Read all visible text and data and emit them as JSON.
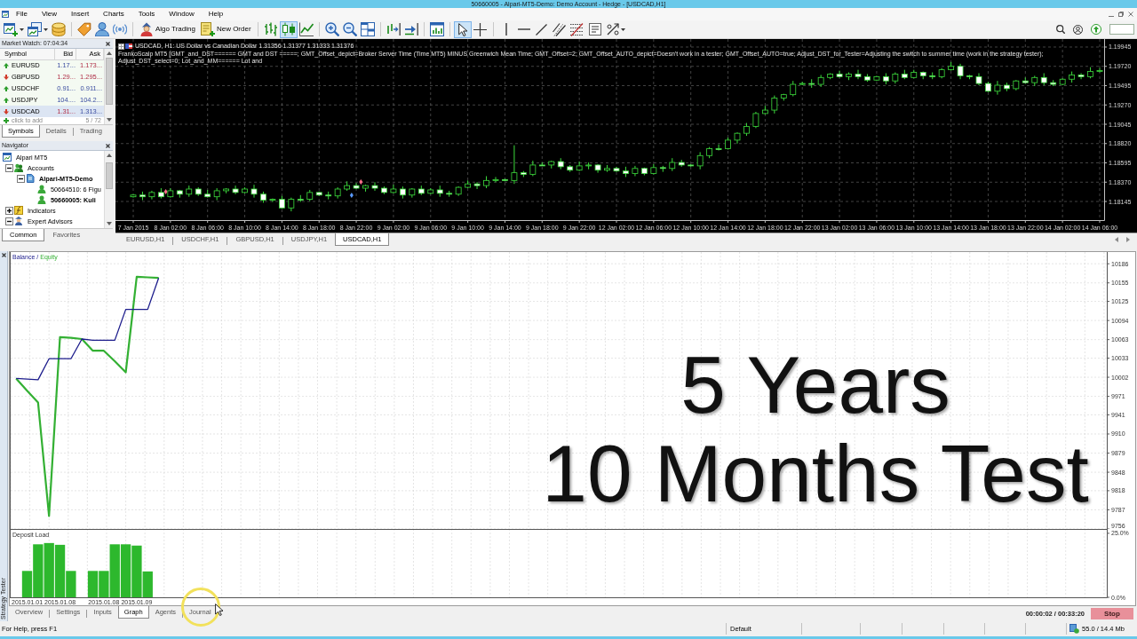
{
  "window": {
    "title": "50660005 - Alpari-MT5-Demo: Demo Account - Hedge - [USDCAD,H1]"
  },
  "menu": [
    "File",
    "View",
    "Insert",
    "Charts",
    "Tools",
    "Window",
    "Help"
  ],
  "toolbar": [
    [
      {
        "kind": "new-chart",
        "dropdown": true,
        "selected": false
      },
      {
        "kind": "profiles",
        "dropdown": true,
        "selected": false
      },
      {
        "kind": "market-watch",
        "dropdown": false,
        "selected": false
      }
    ],
    [
      {
        "kind": "data-window",
        "dropdown": false,
        "selected": false
      },
      {
        "kind": "navigator",
        "dropdown": false,
        "selected": false
      },
      {
        "kind": "signals",
        "dropdown": false,
        "selected": false
      }
    ],
    [
      {
        "kind": "algo-trading",
        "label": "Algo Trading",
        "dropdown": false,
        "selected": false
      },
      {
        "kind": "new-order",
        "label": "New Order",
        "dropdown": false,
        "selected": false
      }
    ],
    [
      {
        "kind": "bar-chart",
        "dropdown": false,
        "selected": false
      },
      {
        "kind": "candlestick-chart",
        "dropdown": false,
        "selected": true
      },
      {
        "kind": "line-chart",
        "dropdown": false,
        "selected": false
      }
    ],
    [
      {
        "kind": "zoom-in",
        "dropdown": false,
        "selected": false
      },
      {
        "kind": "zoom-out",
        "dropdown": false,
        "selected": false
      },
      {
        "kind": "tile-windows",
        "dropdown": false,
        "selected": false
      }
    ],
    [
      {
        "kind": "chart-shift",
        "dropdown": false,
        "selected": false
      },
      {
        "kind": "autoscroll",
        "dropdown": false,
        "selected": false
      }
    ],
    [
      {
        "kind": "templates",
        "dropdown": false,
        "selected": false
      }
    ],
    [
      {
        "kind": "cursor",
        "dropdown": false,
        "selected": true
      },
      {
        "kind": "crosshair",
        "dropdown": false,
        "selected": false
      }
    ],
    [
      {
        "kind": "vertical-line",
        "dropdown": false,
        "selected": false
      },
      {
        "kind": "horizontal-line",
        "dropdown": false,
        "selected": false
      },
      {
        "kind": "trend-line",
        "dropdown": false,
        "selected": false
      },
      {
        "kind": "channel",
        "dropdown": false,
        "selected": false
      },
      {
        "kind": "fibonacci",
        "dropdown": false,
        "selected": false
      },
      {
        "kind": "text-label",
        "dropdown": false,
        "selected": false
      },
      {
        "kind": "arrows",
        "dropdown": true,
        "selected": false
      }
    ]
  ],
  "market_watch": {
    "title": "Market Watch: 07:04:34",
    "columns": [
      "Symbol",
      "Bid",
      "Ask"
    ],
    "rows": [
      {
        "symbol": "EURUSD",
        "rising": true,
        "bid": "1.17...",
        "bid_down": false,
        "ask": "1.173...",
        "ask_down": true,
        "selected": false
      },
      {
        "symbol": "GBPUSD",
        "rising": false,
        "bid": "1.29...",
        "bid_down": true,
        "ask": "1.295...",
        "ask_down": true,
        "selected": false
      },
      {
        "symbol": "USDCHF",
        "rising": true,
        "bid": "0.91...",
        "bid_down": false,
        "ask": "0.911...",
        "ask_down": false,
        "selected": false
      },
      {
        "symbol": "USDJPY",
        "rising": true,
        "bid": "104....",
        "bid_down": false,
        "ask": "104.2...",
        "ask_down": false,
        "selected": false
      },
      {
        "symbol": "USDCAD",
        "rising": false,
        "bid": "1.31...",
        "bid_down": true,
        "ask": "1.313...",
        "ask_down": false,
        "selected": true
      }
    ],
    "add_row": {
      "label": "click to add",
      "count": "5 / 72"
    },
    "tabs": [
      {
        "label": "Symbols",
        "selected": true
      },
      {
        "label": "Details",
        "selected": false
      },
      {
        "label": "Trading",
        "selected": false
      }
    ]
  },
  "navigator": {
    "title": "Navigator",
    "tree": [
      {
        "label": "Alpari MT5",
        "kind": "terminal",
        "active": false,
        "children": [
          {
            "label": "Accounts",
            "kind": "accounts",
            "expanded": true,
            "active": false,
            "children": [
              {
                "label": "Alpari-MT5-Demo",
                "kind": "server",
                "expanded": true,
                "active": true,
                "children": [
                  {
                    "label": "50664510: 6 Figu",
                    "kind": "account",
                    "active": false
                  },
                  {
                    "label": "50660005: Kuli",
                    "kind": "account",
                    "active": true
                  }
                ]
              }
            ]
          },
          {
            "label": "Indicators",
            "kind": "indicators",
            "expanded": false,
            "active": false
          },
          {
            "label": "Expert Advisors",
            "kind": "experts",
            "expanded": true,
            "active": false
          }
        ]
      }
    ],
    "tabs": [
      {
        "label": "Common",
        "selected": true
      },
      {
        "label": "Favorites",
        "selected": false
      }
    ]
  },
  "chart": {
    "header": "USDCAD, H1: US Dollar vs Canadian Dollar 1.31356 1.31377 1.31333 1.31376",
    "indicator": "FrankoScalp MT5 [GMT_and_DST====== GMT and DST =====; GMT_Offset_depict=Broker Server Time (Time MT5) MINUS Greenwich Mean Time; GMT_Offset=2; GMT_Offset_AUTO_depict=Doesn't work in a tester; GMT_Offset_AUTO=true; Adjust_DST_for_Tester=Adjusting the switch to summer time (work in the strategy tester); Adjust_DST_select=0; Lot_and_MM====== Lot and",
    "chart_data": {
      "type": "candlestick",
      "grid": true,
      "categories": [
        "7 Jan 2015",
        null,
        null,
        null,
        "8 Jan 02:00",
        null,
        null,
        null,
        "8 Jan 06:00",
        null,
        null,
        null,
        "8 Jan 10:00",
        null,
        null,
        null,
        "8 Jan 14:00",
        null,
        null,
        null,
        "8 Jan 18:00",
        null,
        null,
        null,
        "8 Jan 22:00",
        null,
        null,
        null,
        "9 Jan 02:00",
        null,
        null,
        null,
        "9 Jan 06:00",
        null,
        null,
        null,
        "9 Jan 10:00",
        null,
        null,
        null,
        "9 Jan 14:00",
        null,
        null,
        null,
        "9 Jan 18:00",
        null,
        null,
        null,
        "9 Jan 22:00",
        null,
        null,
        null,
        "12 Jan 02:00",
        null,
        null,
        null,
        "12 Jan 06:00",
        null,
        null,
        null,
        "12 Jan 10:00",
        null,
        null,
        null,
        "12 Jan 14:00",
        null,
        null,
        null,
        "12 Jan 18:00",
        null,
        null,
        null,
        "12 Jan 22:00",
        null,
        null,
        null,
        "13 Jan 02:00",
        null,
        null,
        null,
        "13 Jan 06:00",
        null,
        null,
        null,
        "13 Jan 10:00",
        null,
        null,
        null,
        "13 Jan 14:00",
        null,
        null,
        null,
        "13 Jan 18:00",
        null,
        null,
        null,
        "13 Jan 22:00",
        null,
        null,
        null,
        "14 Jan 02:00",
        null,
        null,
        null,
        "14 Jan 06:00"
      ],
      "ohlc": [
        [
          1.182,
          1.1823,
          1.1819,
          1.1822
        ],
        [
          1.1822,
          1.1826,
          1.1816,
          1.182
        ],
        [
          1.182,
          1.1827,
          1.1817,
          1.1825
        ],
        [
          1.1825,
          1.183,
          1.1818,
          1.182
        ],
        [
          1.182,
          1.183,
          1.1819,
          1.1827
        ],
        [
          1.1827,
          1.1828,
          1.1819,
          1.1823
        ],
        [
          1.1823,
          1.1833,
          1.182,
          1.1829
        ],
        [
          1.1829,
          1.1831,
          1.1821,
          1.1823
        ],
        [
          1.1823,
          1.1828,
          1.1819,
          1.182
        ],
        [
          1.182,
          1.183,
          1.1816,
          1.1827
        ],
        [
          1.1827,
          1.183,
          1.1824,
          1.1829
        ],
        [
          1.1829,
          1.1833,
          1.1823,
          1.1825
        ],
        [
          1.1825,
          1.1831,
          1.1824,
          1.1829
        ],
        [
          1.1829,
          1.1834,
          1.1819,
          1.1823
        ],
        [
          1.1823,
          1.1826,
          1.1813,
          1.1816
        ],
        [
          1.1816,
          1.1818,
          1.1814,
          1.1817
        ],
        [
          1.1817,
          1.1821,
          1.1806,
          1.1807
        ],
        [
          1.1807,
          1.1819,
          1.1803,
          1.1817
        ],
        [
          1.1817,
          1.1822,
          1.1814,
          1.1817
        ],
        [
          1.1817,
          1.1828,
          1.1815,
          1.1825
        ],
        [
          1.1825,
          1.1826,
          1.1821,
          1.1822
        ],
        [
          1.1822,
          1.1826,
          1.1817,
          1.1821
        ],
        [
          1.1821,
          1.1831,
          1.1818,
          1.1829
        ],
        [
          1.1829,
          1.1838,
          1.1827,
          1.1833
        ],
        [
          1.1833,
          1.1836,
          1.1829,
          1.183
        ],
        [
          1.183,
          1.1834,
          1.1826,
          1.1833
        ],
        [
          1.1833,
          1.1837,
          1.1827,
          1.183
        ],
        [
          1.183,
          1.1832,
          1.1823,
          1.1825
        ],
        [
          1.1825,
          1.1834,
          1.1824,
          1.1829
        ],
        [
          1.1829,
          1.1832,
          1.1818,
          1.1822
        ],
        [
          1.1822,
          1.183,
          1.1819,
          1.1829
        ],
        [
          1.1829,
          1.1833,
          1.1822,
          1.1824
        ],
        [
          1.1824,
          1.183,
          1.1823,
          1.1828
        ],
        [
          1.1828,
          1.1833,
          1.182,
          1.1824
        ],
        [
          1.1824,
          1.1827,
          1.182,
          1.1823
        ],
        [
          1.1823,
          1.1832,
          1.1821,
          1.1831
        ],
        [
          1.1831,
          1.1839,
          1.183,
          1.1835
        ],
        [
          1.1835,
          1.1837,
          1.1829,
          1.1833
        ],
        [
          1.1833,
          1.1844,
          1.183,
          1.1839
        ],
        [
          1.1839,
          1.1843,
          1.1837,
          1.184
        ],
        [
          1.184,
          1.1841,
          1.1838,
          1.1839
        ],
        [
          1.1839,
          1.188,
          1.1835,
          1.1848
        ],
        [
          1.1848,
          1.185,
          1.1843,
          1.1846
        ],
        [
          1.1846,
          1.1862,
          1.1844,
          1.1857
        ],
        [
          1.1857,
          1.186,
          1.1856,
          1.1857
        ],
        [
          1.1857,
          1.1862,
          1.1853,
          1.1861
        ],
        [
          1.1861,
          1.1865,
          1.1852,
          1.1855
        ],
        [
          1.1855,
          1.1857,
          1.1849,
          1.1851
        ],
        [
          1.1851,
          1.1861,
          1.185,
          1.1856
        ],
        [
          1.1856,
          1.186,
          1.1852,
          1.1857
        ],
        [
          1.1857,
          1.1858,
          1.1848,
          1.1851
        ],
        [
          1.1851,
          1.1857,
          1.1849,
          1.1853
        ],
        [
          1.1853,
          1.1855,
          1.1849,
          1.185
        ],
        [
          1.185,
          1.1855,
          1.1843,
          1.1847
        ],
        [
          1.1847,
          1.1856,
          1.1844,
          1.1853
        ],
        [
          1.1853,
          1.1854,
          1.1845,
          1.1847
        ],
        [
          1.1847,
          1.1858,
          1.1846,
          1.1854
        ],
        [
          1.1854,
          1.1856,
          1.1849,
          1.1853
        ],
        [
          1.1853,
          1.1865,
          1.185,
          1.186
        ],
        [
          1.186,
          1.1863,
          1.1855,
          1.1857
        ],
        [
          1.1857,
          1.1858,
          1.1855,
          1.1856
        ],
        [
          1.1856,
          1.1872,
          1.1852,
          1.1868
        ],
        [
          1.1868,
          1.1878,
          1.1865,
          1.1876
        ],
        [
          1.1876,
          1.1881,
          1.1874,
          1.1876
        ],
        [
          1.1876,
          1.1889,
          1.1875,
          1.1886
        ],
        [
          1.1886,
          1.1895,
          1.1882,
          1.1894
        ],
        [
          1.1894,
          1.1906,
          1.1891,
          1.1902
        ],
        [
          1.1902,
          1.1919,
          1.19,
          1.1917
        ],
        [
          1.1917,
          1.1926,
          1.1916,
          1.1921
        ],
        [
          1.1921,
          1.1938,
          1.1917,
          1.1935
        ],
        [
          1.1935,
          1.194,
          1.1932,
          1.1939
        ],
        [
          1.1939,
          1.1955,
          1.1937,
          1.1951
        ],
        [
          1.1951,
          1.1954,
          1.195,
          1.1952
        ],
        [
          1.1952,
          1.1957,
          1.1947,
          1.1951
        ],
        [
          1.1951,
          1.1962,
          1.1948,
          1.1959
        ],
        [
          1.1959,
          1.1964,
          1.1957,
          1.1963
        ],
        [
          1.1963,
          1.1967,
          1.1959,
          1.196
        ],
        [
          1.196,
          1.1965,
          1.1956,
          1.1963
        ],
        [
          1.1963,
          1.1968,
          1.1957,
          1.196
        ],
        [
          1.196,
          1.1963,
          1.1954,
          1.1956
        ],
        [
          1.1956,
          1.1961,
          1.1955,
          1.196
        ],
        [
          1.196,
          1.1964,
          1.1951,
          1.1955
        ],
        [
          1.1955,
          1.1965,
          1.1952,
          1.1963
        ],
        [
          1.1963,
          1.1968,
          1.1957,
          1.1959
        ],
        [
          1.1959,
          1.1968,
          1.1958,
          1.1965
        ],
        [
          1.1965,
          1.1966,
          1.1957,
          1.1961
        ],
        [
          1.1961,
          1.1965,
          1.1957,
          1.196
        ],
        [
          1.196,
          1.197,
          1.1958,
          1.1968
        ],
        [
          1.1968,
          1.1977,
          1.1967,
          1.1972
        ],
        [
          1.1972,
          1.1975,
          1.1957,
          1.1961
        ],
        [
          1.1961,
          1.1962,
          1.1957,
          1.196
        ],
        [
          1.196,
          1.1964,
          1.195,
          1.1952
        ],
        [
          1.1952,
          1.1954,
          1.1942,
          1.1943
        ],
        [
          1.1943,
          1.1955,
          1.1939,
          1.195
        ],
        [
          1.195,
          1.1953,
          1.1943,
          1.1946
        ],
        [
          1.1946,
          1.1956,
          1.1944,
          1.1955
        ],
        [
          1.1955,
          1.1959,
          1.1952,
          1.1953
        ],
        [
          1.1953,
          1.1961,
          1.1949,
          1.1959
        ],
        [
          1.1959,
          1.1964,
          1.195,
          1.1953
        ],
        [
          1.1953,
          1.1956,
          1.1949,
          1.1951
        ],
        [
          1.1951,
          1.1958,
          1.195,
          1.1957
        ],
        [
          1.1957,
          1.1966,
          1.1953,
          1.1962
        ],
        [
          1.1962,
          1.1964,
          1.1957,
          1.196
        ],
        [
          1.196,
          1.1971,
          1.1958,
          1.1966
        ],
        [
          1.1966,
          1.197,
          1.1965,
          1.1967
        ]
      ],
      "ylim": [
        1.17928,
        1.20038
      ],
      "yticks": [
        {
          "value": 1.19945,
          "label": "1.19945"
        },
        {
          "value": 1.1972,
          "label": "1.19720"
        },
        {
          "value": 1.19495,
          "label": "1.19495"
        },
        {
          "value": 1.1927,
          "label": "1.19270"
        },
        {
          "value": 1.19045,
          "label": "1.19045"
        },
        {
          "value": 1.1882,
          "label": "1.18820"
        },
        {
          "value": 1.18595,
          "label": "1.18595"
        },
        {
          "value": 1.1837,
          "label": "1.18370"
        },
        {
          "value": 1.18145,
          "label": "1.18145"
        }
      ]
    },
    "tabs": [
      {
        "label": "EURUSD,H1",
        "selected": false
      },
      {
        "label": "USDCHF,H1",
        "selected": false
      },
      {
        "label": "GBPUSD,H1",
        "selected": false
      },
      {
        "label": "USDJPY,H1",
        "selected": false
      },
      {
        "label": "USDCAD,H1",
        "selected": true
      }
    ]
  },
  "tester": {
    "side_title": "Strategy Tester",
    "balance_chart": {
      "legend_separator": "/",
      "chart_data": {
        "type": "line",
        "grid": true,
        "categories": [
          null,
          null,
          null,
          null,
          null,
          null,
          null,
          null,
          null,
          null,
          null,
          null,
          null,
          null,
          null,
          null,
          null,
          null,
          null,
          null,
          null,
          null,
          null,
          null,
          null,
          null,
          null,
          null,
          null,
          null,
          null,
          null,
          null,
          null,
          null,
          null,
          null,
          null,
          null,
          null,
          null,
          null,
          null,
          null,
          null,
          null,
          null,
          null,
          null,
          null,
          null,
          null,
          null,
          null,
          null,
          null,
          null,
          null,
          null,
          null,
          null,
          null,
          null,
          null,
          null,
          null,
          null,
          null,
          null,
          null,
          null,
          null,
          null,
          null,
          null,
          null,
          null,
          null,
          null,
          null,
          null,
          null,
          null,
          null,
          null,
          null,
          null,
          null,
          null,
          null,
          null,
          null,
          null,
          null,
          null,
          null,
          null,
          null,
          null,
          null
        ],
        "series": [
          {
            "name": "Balance",
            "color": "#1c1c8c",
            "values": [
              10000,
              9999,
              9998,
              10032,
              10032,
              10032,
              10064,
              10062,
              10062,
              10062,
              10112,
              10112,
              10112,
              10163,
              null,
              null,
              null,
              null,
              null,
              null,
              null,
              null,
              null,
              null,
              null,
              null,
              null,
              null,
              null,
              null,
              null,
              null,
              null,
              null,
              null,
              null,
              null,
              null,
              null,
              null,
              null,
              null,
              null,
              null,
              null,
              null,
              null,
              null,
              null,
              null,
              null,
              null,
              null,
              null,
              null,
              null,
              null,
              null,
              null,
              null,
              null,
              null,
              null,
              null,
              null,
              null,
              null,
              null,
              null,
              null,
              null,
              null,
              null,
              null,
              null,
              null,
              null,
              null,
              null,
              null,
              null,
              null,
              null,
              null,
              null,
              null,
              null,
              null,
              null,
              null,
              null,
              null,
              null,
              null,
              null,
              null,
              null,
              null,
              null,
              null
            ]
          },
          {
            "name": "Equity",
            "color": "#33b033",
            "values": [
              10000,
              9980,
              9961,
              9777,
              10067,
              10066,
              10064,
              10045,
              10045,
              10028,
              10010,
              10165,
              10164,
              10163,
              null,
              null,
              null,
              null,
              null,
              null,
              null,
              null,
              null,
              null,
              null,
              null,
              null,
              null,
              null,
              null,
              null,
              null,
              null,
              null,
              null,
              null,
              null,
              null,
              null,
              null,
              null,
              null,
              null,
              null,
              null,
              null,
              null,
              null,
              null,
              null,
              null,
              null,
              null,
              null,
              null,
              null,
              null,
              null,
              null,
              null,
              null,
              null,
              null,
              null,
              null,
              null,
              null,
              null,
              null,
              null,
              null,
              null,
              null,
              null,
              null,
              null,
              null,
              null,
              null,
              null,
              null,
              null,
              null,
              null,
              null,
              null,
              null,
              null,
              null,
              null,
              null,
              null,
              null,
              null,
              null,
              null,
              null,
              null,
              null,
              null
            ]
          }
        ],
        "ylim": [
          9756,
          10205
        ],
        "yticks": [
          10186,
          10155,
          10125,
          10094,
          10063,
          10033,
          10002,
          9971,
          9941,
          9910,
          9879,
          9848,
          9818,
          9787,
          9756
        ]
      }
    },
    "deposit_chart": {
      "chart_data": {
        "type": "bar",
        "grid": true,
        "title": "Deposit Load",
        "categories": [
          null,
          "2015.01.01",
          null,
          null,
          "2015.01.08",
          null,
          null,
          null,
          "2015.01.08",
          null,
          null,
          "2015.01.09",
          null,
          null,
          null,
          null,
          null,
          null,
          null,
          null,
          null,
          null,
          null,
          null,
          null,
          null,
          null,
          null,
          null,
          null,
          null,
          null,
          null,
          null,
          null,
          null,
          null,
          null,
          null,
          null,
          null,
          null,
          null,
          null,
          null,
          null,
          null,
          null,
          null,
          null,
          null,
          null,
          null,
          null,
          null,
          null,
          null,
          null,
          null,
          null,
          null,
          null,
          null,
          null,
          null,
          null,
          null,
          null,
          null,
          null,
          null,
          null,
          null,
          null,
          null,
          null,
          null,
          null,
          null,
          null,
          null,
          null,
          null,
          null,
          null,
          null,
          null,
          null,
          null,
          null,
          null,
          null,
          null,
          null,
          null,
          null,
          null,
          null,
          null,
          null
        ],
        "values": [
          null,
          10.3,
          20.7,
          21.2,
          20.5,
          10.3,
          null,
          10.3,
          10.3,
          20.7,
          20.7,
          20.2,
          10.1,
          null,
          null,
          null,
          null,
          null,
          null,
          null,
          null,
          null,
          null,
          null,
          null,
          null,
          null,
          null,
          null,
          null,
          null,
          null,
          null,
          null,
          null,
          null,
          null,
          null,
          null,
          null,
          null,
          null,
          null,
          null,
          null,
          null,
          null,
          null,
          null,
          null,
          null,
          null,
          null,
          null,
          null,
          null,
          null,
          null,
          null,
          null,
          null,
          null,
          null,
          null,
          null,
          null,
          null,
          null,
          null,
          null,
          null,
          null,
          null,
          null,
          null,
          null,
          null,
          null,
          null,
          null,
          null,
          null,
          null,
          null,
          null,
          null,
          null,
          null,
          null,
          null,
          null,
          null,
          null,
          null,
          null,
          null,
          null,
          null,
          null,
          null
        ],
        "ylim": [
          0,
          26.7
        ],
        "yticks": [
          {
            "value": 0,
            "label": "0.0%"
          },
          {
            "value": 25,
            "label": "25.0%"
          }
        ]
      }
    },
    "tabs": [
      {
        "label": "Overview",
        "selected": false
      },
      {
        "label": "Settings",
        "selected": false
      },
      {
        "label": "Inputs",
        "selected": false
      },
      {
        "label": "Graph",
        "selected": true
      },
      {
        "label": "Agents",
        "selected": false
      },
      {
        "label": "Journal",
        "selected": false
      }
    ],
    "timer": "00:00:02 / 00:33:20",
    "stop_label": "Stop"
  },
  "caption": [
    "5 Years",
    "10 Months Test"
  ],
  "status_bar": {
    "help": "For Help, press F1",
    "profile": "Default",
    "memory": "55.0 / 14.4 Mb"
  }
}
